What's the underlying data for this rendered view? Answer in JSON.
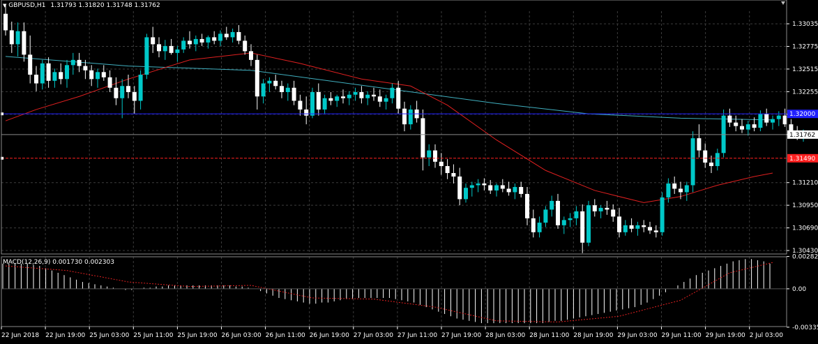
{
  "header": {
    "symbol": "GBPUSD,H1",
    "ohlc": "1.31793 1.31820 1.31748 1.31762"
  },
  "macd": {
    "label": "MACD(12,26,9) 0.001730 0.002303"
  },
  "price_scale": {
    "ticks": [
      "1.33035",
      "1.32775",
      "1.32515",
      "1.32255",
      "1.31995",
      "1.31762",
      "1.31210",
      "1.30950",
      "1.30690",
      "1.30430"
    ],
    "current_price": "1.31762",
    "blue_level": "1.32000",
    "red_level": "1.31490"
  },
  "macd_scale": {
    "ticks": [
      "0.002826",
      "0.00",
      "-0.003355"
    ]
  },
  "time_axis": {
    "labels": [
      "22 Jun 2018",
      "22 Jun 19:00",
      "25 Jun 03:00",
      "25 Jun 11:00",
      "25 Jun 19:00",
      "26 Jun 03:00",
      "26 Jun 11:00",
      "26 Jun 19:00",
      "27 Jun 03:00",
      "27 Jun 11:00",
      "27 Jun 19:00",
      "28 Jun 03:00",
      "28 Jun 11:00",
      "28 Jun 19:00",
      "29 Jun 03:00",
      "29 Jun 11:00",
      "29 Jun 19:00",
      "2 Jul 03:00"
    ]
  },
  "colors": {
    "background": "#000000",
    "grid": "#3c3c3c",
    "bull": "#00c8c8",
    "bear": "#ffffff",
    "ma_red": "#e02020",
    "ma_cyan": "#40b0c0",
    "line_blue": "#2020ff",
    "line_red": "#ff2020",
    "macd_signal": "#e02020",
    "histogram": "#ffffff"
  },
  "chart_data": {
    "type": "candlestick",
    "symbol": "GBPUSD",
    "timeframe": "H1",
    "y_range": [
      1.3039,
      1.3318
    ],
    "horizontal_levels": [
      1.32,
      1.3149
    ],
    "ohlc": [
      [
        1.3315,
        1.3325,
        1.329,
        1.3296
      ],
      [
        1.3296,
        1.3306,
        1.327,
        1.328
      ],
      [
        1.328,
        1.3305,
        1.3266,
        1.3295
      ],
      [
        1.3295,
        1.3305,
        1.326,
        1.3268
      ],
      [
        1.3268,
        1.329,
        1.3235,
        1.3245
      ],
      [
        1.3245,
        1.3255,
        1.3226,
        1.3235
      ],
      [
        1.3235,
        1.3262,
        1.3228,
        1.3258
      ],
      [
        1.3258,
        1.3265,
        1.323,
        1.3238
      ],
      [
        1.3238,
        1.3252,
        1.323,
        1.3248
      ],
      [
        1.3248,
        1.3258,
        1.3234,
        1.324
      ],
      [
        1.324,
        1.3262,
        1.323,
        1.3256
      ],
      [
        1.3256,
        1.327,
        1.3245,
        1.3262
      ],
      [
        1.3262,
        1.327,
        1.3248,
        1.3255
      ],
      [
        1.3255,
        1.3262,
        1.324,
        1.325
      ],
      [
        1.325,
        1.3256,
        1.3232,
        1.324
      ],
      [
        1.324,
        1.3252,
        1.323,
        1.3248
      ],
      [
        1.3248,
        1.3256,
        1.3238,
        1.3242
      ],
      [
        1.3242,
        1.325,
        1.3225,
        1.323
      ],
      [
        1.323,
        1.3242,
        1.321,
        1.3218
      ],
      [
        1.3218,
        1.324,
        1.3195,
        1.3232
      ],
      [
        1.3232,
        1.3245,
        1.3218,
        1.3225
      ],
      [
        1.3225,
        1.3232,
        1.32,
        1.3215
      ],
      [
        1.3215,
        1.325,
        1.3205,
        1.3245
      ],
      [
        1.3245,
        1.3292,
        1.324,
        1.3288
      ],
      [
        1.3288,
        1.33,
        1.327,
        1.328
      ],
      [
        1.328,
        1.3288,
        1.3265,
        1.3272
      ],
      [
        1.3272,
        1.3285,
        1.3262,
        1.3278
      ],
      [
        1.3278,
        1.3286,
        1.3268,
        1.327
      ],
      [
        1.327,
        1.3278,
        1.326,
        1.3274
      ],
      [
        1.3274,
        1.3288,
        1.327,
        1.3284
      ],
      [
        1.3284,
        1.3295,
        1.3275,
        1.328
      ],
      [
        1.328,
        1.329,
        1.3272,
        1.3286
      ],
      [
        1.3286,
        1.3292,
        1.3278,
        1.3282
      ],
      [
        1.3282,
        1.329,
        1.3275,
        1.3288
      ],
      [
        1.3288,
        1.3295,
        1.328,
        1.3284
      ],
      [
        1.3284,
        1.3296,
        1.3278,
        1.3292
      ],
      [
        1.3292,
        1.33,
        1.3285,
        1.3288
      ],
      [
        1.3288,
        1.3298,
        1.3282,
        1.3294
      ],
      [
        1.3294,
        1.3302,
        1.328,
        1.3284
      ],
      [
        1.3284,
        1.329,
        1.3268,
        1.3272
      ],
      [
        1.3272,
        1.328,
        1.3255,
        1.3262
      ],
      [
        1.3262,
        1.3268,
        1.3205,
        1.322
      ],
      [
        1.322,
        1.324,
        1.3212,
        1.3235
      ],
      [
        1.3235,
        1.3242,
        1.3225,
        1.3238
      ],
      [
        1.3238,
        1.3245,
        1.3228,
        1.3232
      ],
      [
        1.3232,
        1.3238,
        1.3218,
        1.3225
      ],
      [
        1.3225,
        1.3235,
        1.3215,
        1.323
      ],
      [
        1.323,
        1.3238,
        1.321,
        1.3215
      ],
      [
        1.3215,
        1.3222,
        1.3198,
        1.3205
      ],
      [
        1.3205,
        1.322,
        1.3188,
        1.3198
      ],
      [
        1.3198,
        1.323,
        1.3195,
        1.3225
      ],
      [
        1.3225,
        1.3235,
        1.3198,
        1.3205
      ],
      [
        1.3205,
        1.3222,
        1.32,
        1.3218
      ],
      [
        1.3218,
        1.3225,
        1.321,
        1.3215
      ],
      [
        1.3215,
        1.3222,
        1.3208,
        1.322
      ],
      [
        1.322,
        1.3228,
        1.3212,
        1.3218
      ],
      [
        1.3218,
        1.3226,
        1.321,
        1.3222
      ],
      [
        1.3222,
        1.323,
        1.3215,
        1.3225
      ],
      [
        1.3225,
        1.3232,
        1.3212,
        1.3218
      ],
      [
        1.3218,
        1.3226,
        1.321,
        1.3222
      ],
      [
        1.3222,
        1.323,
        1.3215,
        1.322
      ],
      [
        1.322,
        1.3228,
        1.3208,
        1.3214
      ],
      [
        1.3214,
        1.3222,
        1.3205,
        1.3218
      ],
      [
        1.3218,
        1.3235,
        1.3212,
        1.323
      ],
      [
        1.323,
        1.3238,
        1.32,
        1.3206
      ],
      [
        1.3206,
        1.3214,
        1.318,
        1.3188
      ],
      [
        1.3188,
        1.321,
        1.3182,
        1.3205
      ],
      [
        1.3205,
        1.3215,
        1.319,
        1.3195
      ],
      [
        1.3195,
        1.3205,
        1.3135,
        1.315
      ],
      [
        1.315,
        1.3165,
        1.314,
        1.3158
      ],
      [
        1.3158,
        1.3165,
        1.3138,
        1.3145
      ],
      [
        1.3145,
        1.3155,
        1.313,
        1.314
      ],
      [
        1.314,
        1.3148,
        1.3125,
        1.3132
      ],
      [
        1.3132,
        1.3142,
        1.312,
        1.3128
      ],
      [
        1.3128,
        1.3138,
        1.3095,
        1.3102
      ],
      [
        1.3102,
        1.312,
        1.3098,
        1.3115
      ],
      [
        1.3115,
        1.3122,
        1.3105,
        1.3118
      ],
      [
        1.3118,
        1.3125,
        1.311,
        1.312
      ],
      [
        1.312,
        1.3126,
        1.3112,
        1.3118
      ],
      [
        1.3118,
        1.3124,
        1.3108,
        1.3112
      ],
      [
        1.3112,
        1.312,
        1.3105,
        1.3118
      ],
      [
        1.3118,
        1.3125,
        1.311,
        1.3114
      ],
      [
        1.3114,
        1.3122,
        1.3106,
        1.311
      ],
      [
        1.311,
        1.312,
        1.3102,
        1.3116
      ],
      [
        1.3116,
        1.3122,
        1.3104,
        1.3108
      ],
      [
        1.3108,
        1.3116,
        1.3072,
        1.308
      ],
      [
        1.308,
        1.309,
        1.3058,
        1.3064
      ],
      [
        1.3064,
        1.3082,
        1.3058,
        1.3075
      ],
      [
        1.3075,
        1.3094,
        1.307,
        1.309
      ],
      [
        1.309,
        1.3106,
        1.3082,
        1.31
      ],
      [
        1.31,
        1.3108,
        1.3068,
        1.3072
      ],
      [
        1.3072,
        1.3082,
        1.3062,
        1.3078
      ],
      [
        1.3078,
        1.3086,
        1.307,
        1.308
      ],
      [
        1.308,
        1.3094,
        1.3072,
        1.3088
      ],
      [
        1.3088,
        1.3096,
        1.304,
        1.3052
      ],
      [
        1.3052,
        1.31,
        1.3048,
        1.3095
      ],
      [
        1.3095,
        1.3102,
        1.3082,
        1.3088
      ],
      [
        1.3088,
        1.3095,
        1.308,
        1.3092
      ],
      [
        1.3092,
        1.31,
        1.3084,
        1.309
      ],
      [
        1.309,
        1.3096,
        1.3076,
        1.3082
      ],
      [
        1.3082,
        1.3092,
        1.3058,
        1.3064
      ],
      [
        1.3064,
        1.3078,
        1.306,
        1.3072
      ],
      [
        1.3072,
        1.308,
        1.3064,
        1.3068
      ],
      [
        1.3068,
        1.3076,
        1.306,
        1.3072
      ],
      [
        1.3072,
        1.3078,
        1.3064,
        1.307
      ],
      [
        1.307,
        1.3076,
        1.3062,
        1.3066
      ],
      [
        1.3066,
        1.3072,
        1.3058,
        1.3064
      ],
      [
        1.3064,
        1.311,
        1.306,
        1.3104
      ],
      [
        1.3104,
        1.3126,
        1.3098,
        1.312
      ],
      [
        1.312,
        1.3128,
        1.3108,
        1.3114
      ],
      [
        1.3114,
        1.3122,
        1.3102,
        1.311
      ],
      [
        1.311,
        1.3122,
        1.31,
        1.3118
      ],
      [
        1.3118,
        1.318,
        1.311,
        1.3172
      ],
      [
        1.3172,
        1.3188,
        1.315,
        1.3158
      ],
      [
        1.3158,
        1.3166,
        1.3138,
        1.3144
      ],
      [
        1.3144,
        1.3152,
        1.3132,
        1.314
      ],
      [
        1.314,
        1.316,
        1.3135,
        1.3155
      ],
      [
        1.3155,
        1.3205,
        1.315,
        1.3198
      ],
      [
        1.3198,
        1.3206,
        1.3185,
        1.319
      ],
      [
        1.319,
        1.3198,
        1.318,
        1.3186
      ],
      [
        1.3186,
        1.3194,
        1.3178,
        1.3182
      ],
      [
        1.3182,
        1.3192,
        1.3175,
        1.3188
      ],
      [
        1.3188,
        1.3196,
        1.318,
        1.3184
      ],
      [
        1.3184,
        1.3204,
        1.318,
        1.32
      ],
      [
        1.32,
        1.3206,
        1.3186,
        1.319
      ],
      [
        1.319,
        1.3198,
        1.3182,
        1.3194
      ],
      [
        1.3194,
        1.3203,
        1.3186,
        1.3198
      ],
      [
        1.3198,
        1.3206,
        1.3185,
        1.3188
      ],
      [
        1.3188,
        1.3194,
        1.3175,
        1.318
      ],
      [
        1.318,
        1.3186,
        1.317,
        1.3174
      ],
      [
        1.3174,
        1.3182,
        1.3168,
        1.3176
      ]
    ],
    "ma_slow": [
      [
        0,
        1.3266
      ],
      [
        20,
        1.3255
      ],
      [
        40,
        1.325
      ],
      [
        60,
        1.3231
      ],
      [
        80,
        1.3212
      ],
      [
        95,
        1.32
      ],
      [
        110,
        1.3195
      ],
      [
        125,
        1.3193
      ]
    ],
    "ma_fast": [
      [
        0,
        1.3192
      ],
      [
        5,
        1.3205
      ],
      [
        12,
        1.322
      ],
      [
        20,
        1.324
      ],
      [
        30,
        1.3262
      ],
      [
        40,
        1.327
      ],
      [
        48,
        1.3258
      ],
      [
        58,
        1.324
      ],
      [
        66,
        1.3232
      ],
      [
        72,
        1.321
      ],
      [
        80,
        1.317
      ],
      [
        88,
        1.3135
      ],
      [
        96,
        1.3112
      ],
      [
        104,
        1.3098
      ],
      [
        110,
        1.3105
      ],
      [
        116,
        1.3118
      ],
      [
        122,
        1.3128
      ],
      [
        125,
        1.3132
      ]
    ],
    "macd": {
      "y_range": [
        -0.0033,
        0.0028
      ],
      "histogram": [
        0.0022,
        0.0022,
        0.0022,
        0.0022,
        0.0022,
        0.0021,
        0.002,
        0.0018,
        0.0016,
        0.0014,
        0.0012,
        0.001,
        0.0008,
        0.0006,
        0.0005,
        0.0004,
        0.0003,
        0.0002,
        0.0001,
        0.0,
        -0.0001,
        -0.0001,
        0.0,
        0.0001,
        0.0001,
        0.0002,
        0.0002,
        0.0003,
        0.0003,
        0.0003,
        0.0003,
        0.0003,
        0.0003,
        0.0003,
        0.0003,
        0.0003,
        0.0003,
        0.0003,
        0.0002,
        0.0002,
        0.0001,
        0.0,
        -0.0002,
        -0.0004,
        -0.0006,
        -0.0008,
        -0.0009,
        -0.001,
        -0.0011,
        -0.0012,
        -0.0013,
        -0.0013,
        -0.0012,
        -0.0012,
        -0.0011,
        -0.001,
        -0.0009,
        -0.0009,
        -0.0008,
        -0.0008,
        -0.0008,
        -0.0008,
        -0.0008,
        -0.0008,
        -0.0009,
        -0.001,
        -0.0011,
        -0.0012,
        -0.0014,
        -0.0016,
        -0.0018,
        -0.002,
        -0.0022,
        -0.0024,
        -0.0026,
        -0.0027,
        -0.0028,
        -0.0029,
        -0.003,
        -0.003,
        -0.003,
        -0.003,
        -0.003,
        -0.003,
        -0.003,
        -0.003,
        -0.003,
        -0.003,
        -0.003,
        -0.0029,
        -0.0028,
        -0.0028,
        -0.0027,
        -0.0026,
        -0.0025,
        -0.0024,
        -0.0023,
        -0.0022,
        -0.0021,
        -0.002,
        -0.0019,
        -0.0018,
        -0.0017,
        -0.0016,
        -0.0014,
        -0.0012,
        -0.0009,
        -0.0006,
        -0.0003,
        0.0,
        0.0003,
        0.0006,
        0.0009,
        0.0012,
        0.0014,
        0.0016,
        0.0018,
        0.002,
        0.0022,
        0.0024,
        0.0025,
        0.0026,
        0.0026,
        0.0025,
        0.0024,
        0.0022
      ],
      "signal": [
        [
          0,
          0.002
        ],
        [
          10,
          0.0016
        ],
        [
          20,
          0.0006
        ],
        [
          30,
          0.0002
        ],
        [
          40,
          0.0003
        ],
        [
          50,
          -0.0008
        ],
        [
          60,
          -0.0009
        ],
        [
          70,
          -0.0016
        ],
        [
          80,
          -0.0028
        ],
        [
          90,
          -0.0029
        ],
        [
          100,
          -0.0024
        ],
        [
          110,
          -0.001
        ],
        [
          118,
          0.0014
        ],
        [
          125,
          0.0023
        ]
      ]
    }
  }
}
